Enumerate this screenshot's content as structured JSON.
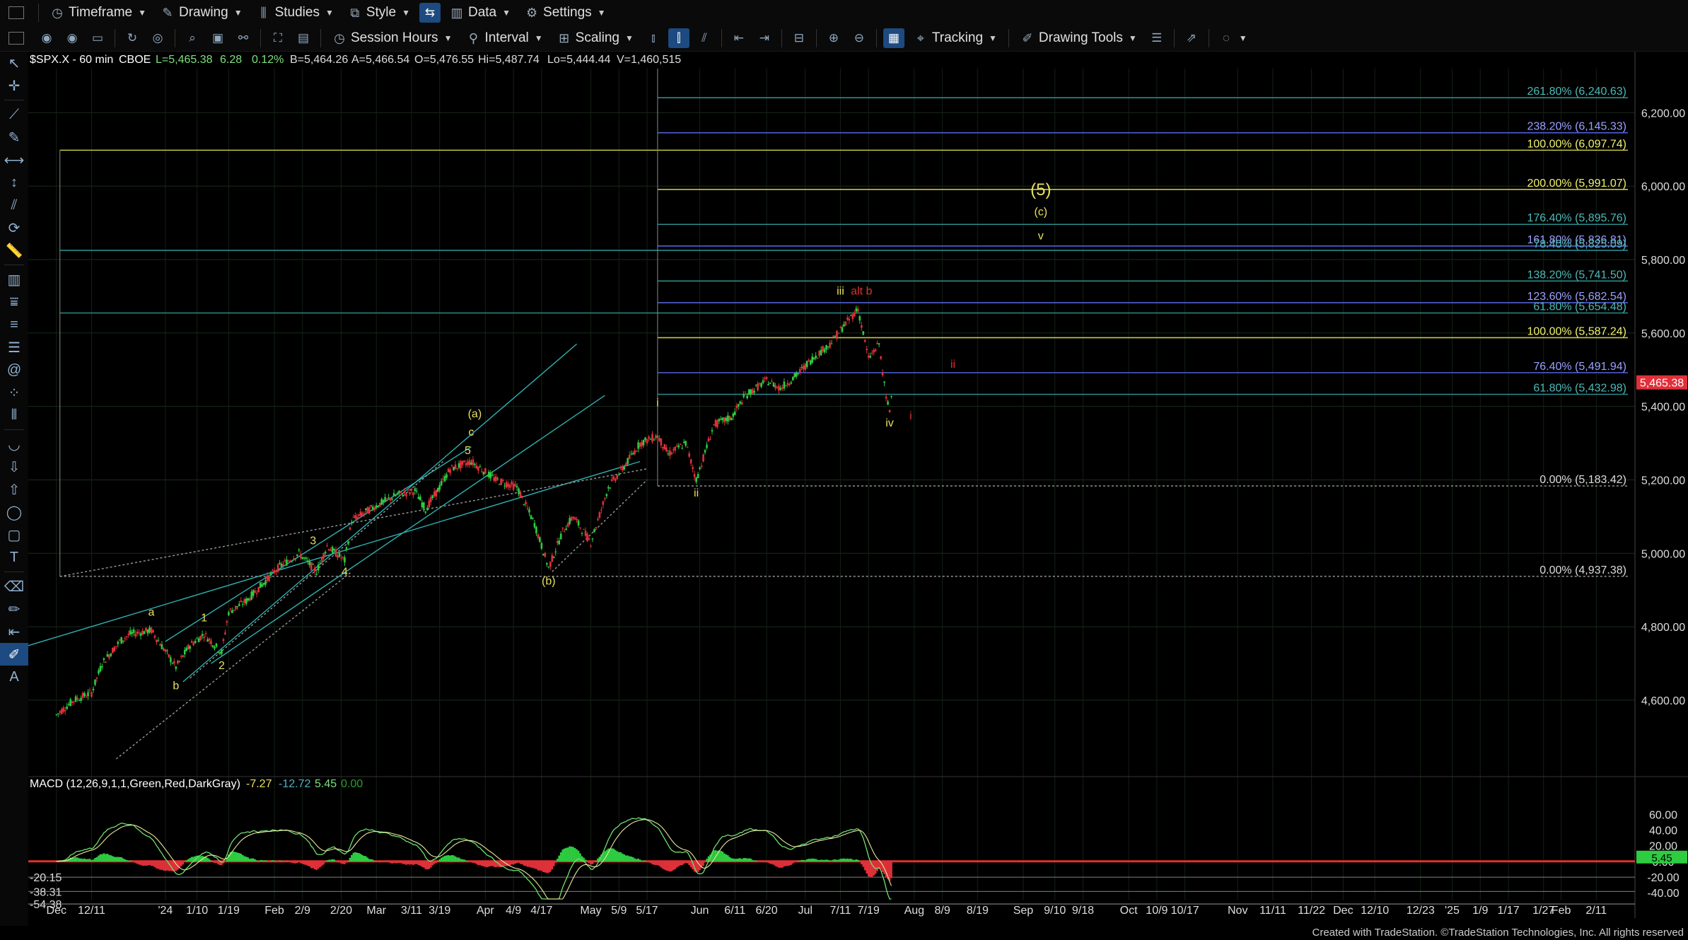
{
  "toolbar_top": {
    "timeframe": "Timeframe",
    "drawing": "Drawing",
    "studies": "Studies",
    "style": "Style",
    "data": "Data",
    "settings": "Settings"
  },
  "toolbar_second": {
    "session_hours": "Session Hours",
    "interval": "Interval",
    "scaling": "Scaling",
    "tracking": "Tracking",
    "drawing_tools": "Drawing Tools"
  },
  "header": {
    "symbol": "$SPX.X - 60 min",
    "exchange": "CBOE",
    "last": "L=5,465.38",
    "change": "6.28",
    "change_pct": "0.12%",
    "bid": "B=5,464.26",
    "ask": "A=5,466.54",
    "open": "O=5,476.55",
    "high": "Hi=5,487.74",
    "low": "Lo=5,444.44",
    "volume": "V=1,460,515"
  },
  "colors": {
    "up": "#2ecc40",
    "down": "#e0303a",
    "fib_teal": "#2a8c8c",
    "fib_blue": "#5060d8",
    "fib_yellow": "#c8c840",
    "label_yellow": "#e8e060",
    "label_red": "#e03030",
    "macd": "#6fe06f",
    "signal": "#e8e8a0",
    "channel": "#30b0b0"
  },
  "chart_data": {
    "type": "candlestick",
    "title": "$SPX.X - 60 min",
    "ylim": [
      4440,
      6320
    ],
    "y_ticks": [
      "4,600.00",
      "4,800.00",
      "5,000.00",
      "5,200.00",
      "5,400.00",
      "5,600.00",
      "5,800.00",
      "6,000.00",
      "6,200.00"
    ],
    "x_ticks": [
      "Dec",
      "12/11",
      "'24",
      "1/10",
      "1/19",
      "Feb",
      "2/9",
      "2/20",
      "Mar",
      "3/11",
      "3/19",
      "Apr",
      "4/9",
      "4/17",
      "May",
      "5/9",
      "5/17",
      "Jun",
      "6/11",
      "6/20",
      "Jul",
      "7/11",
      "7/19",
      "Aug",
      "8/9",
      "8/19",
      "Sep",
      "9/10",
      "9/18",
      "Oct",
      "10/9",
      "10/17",
      "Nov",
      "11/11",
      "11/22",
      "Dec",
      "12/10",
      "12/23",
      "'25",
      "1/9",
      "1/17",
      "1/27",
      "Feb",
      "2/11"
    ],
    "last_price_label": "5,465.38",
    "price_path": [
      [
        "2023-12-01",
        4560
      ],
      [
        "2023-12-06",
        4600
      ],
      [
        "2023-12-11",
        4620
      ],
      [
        "2023-12-14",
        4700
      ],
      [
        "2023-12-19",
        4760
      ],
      [
        "2023-12-22",
        4780
      ],
      [
        "2023-12-28",
        4790
      ],
      [
        "2024-01-04",
        4690
      ],
      [
        "2024-01-08",
        4750
      ],
      [
        "2024-01-12",
        4780
      ],
      [
        "2024-01-17",
        4730
      ],
      [
        "2024-01-19",
        4840
      ],
      [
        "2024-01-24",
        4870
      ],
      [
        "2024-01-29",
        4920
      ],
      [
        "2024-02-02",
        4960
      ],
      [
        "2024-02-08",
        5000
      ],
      [
        "2024-02-13",
        4950
      ],
      [
        "2024-02-16",
        5020
      ],
      [
        "2024-02-21",
        4980
      ],
      [
        "2024-02-23",
        5090
      ],
      [
        "2024-03-01",
        5130
      ],
      [
        "2024-03-07",
        5160
      ],
      [
        "2024-03-12",
        5170
      ],
      [
        "2024-03-15",
        5120
      ],
      [
        "2024-03-19",
        5180
      ],
      [
        "2024-03-22",
        5230
      ],
      [
        "2024-03-28",
        5250
      ],
      [
        "2024-04-04",
        5200
      ],
      [
        "2024-04-10",
        5180
      ],
      [
        "2024-04-15",
        5080
      ],
      [
        "2024-04-19",
        4960
      ],
      [
        "2024-04-23",
        5060
      ],
      [
        "2024-04-26",
        5100
      ],
      [
        "2024-05-01",
        5030
      ],
      [
        "2024-05-06",
        5180
      ],
      [
        "2024-05-10",
        5230
      ],
      [
        "2024-05-15",
        5300
      ],
      [
        "2024-05-20",
        5320
      ],
      [
        "2024-05-23",
        5270
      ],
      [
        "2024-05-28",
        5300
      ],
      [
        "2024-05-31",
        5200
      ],
      [
        "2024-06-05",
        5350
      ],
      [
        "2024-06-10",
        5370
      ],
      [
        "2024-06-14",
        5430
      ],
      [
        "2024-06-20",
        5470
      ],
      [
        "2024-06-24",
        5450
      ],
      [
        "2024-06-28",
        5480
      ],
      [
        "2024-07-03",
        5530
      ],
      [
        "2024-07-08",
        5570
      ],
      [
        "2024-07-12",
        5620
      ],
      [
        "2024-07-16",
        5666
      ],
      [
        "2024-07-19",
        5530
      ],
      [
        "2024-07-22",
        5570
      ],
      [
        "2024-07-24",
        5420
      ],
      [
        "2024-07-25",
        5390
      ],
      [
        "2024-07-26",
        5465
      ]
    ],
    "fib_lines": [
      {
        "label": "261.80% (6,240.63)",
        "price": 6240.63,
        "color": "teal"
      },
      {
        "label": "238.20% (6,145.33)",
        "price": 6145.33,
        "color": "blue"
      },
      {
        "label": "100.00% (6,097.74)",
        "price": 6097.74,
        "color": "yellow"
      },
      {
        "label": "200.00% (5,991.07)",
        "price": 5991.07,
        "color": "yellow"
      },
      {
        "label": "176.40% (5,895.76)",
        "price": 5895.76,
        "color": "teal"
      },
      {
        "label": "161.80% (5,836.81)",
        "price": 5836.81,
        "color": "blue"
      },
      {
        "label": "78.40% (5,825.09)",
        "price": 5825.09,
        "color": "teal"
      },
      {
        "label": "138.20% (5,741.50)",
        "price": 5741.5,
        "color": "teal"
      },
      {
        "label": "123.60% (5,682.54)",
        "price": 5682.54,
        "color": "blue"
      },
      {
        "label": "61.80% (5,654.48)",
        "price": 5654.48,
        "color": "teal"
      },
      {
        "label": "100.00% (5,587.24)",
        "price": 5587.24,
        "color": "yellow"
      },
      {
        "label": "76.40% (5,491.94)",
        "price": 5491.94,
        "color": "blue"
      },
      {
        "label": "61.80% (5,432.98)",
        "price": 5432.98,
        "color": "teal"
      },
      {
        "label": "0.00% (5,183.42)",
        "price": 5183.42,
        "color": "gray"
      },
      {
        "label": "0.00% (4,937.38)",
        "price": 4937.38,
        "color": "gray"
      }
    ],
    "wave_labels": [
      {
        "text": "a",
        "date": "2023-12-28",
        "price": 4830,
        "color": "yellow"
      },
      {
        "text": "b",
        "date": "2024-01-04",
        "price": 4630,
        "color": "yellow"
      },
      {
        "text": "1",
        "date": "2024-01-12",
        "price": 4815,
        "color": "yellow"
      },
      {
        "text": "2",
        "date": "2024-01-17",
        "price": 4685,
        "color": "yellow"
      },
      {
        "text": "3",
        "date": "2024-02-12",
        "price": 5025,
        "color": "yellow"
      },
      {
        "text": "4",
        "date": "2024-02-21",
        "price": 4940,
        "color": "yellow"
      },
      {
        "text": "5",
        "date": "2024-03-27",
        "price": 5270,
        "color": "yellow"
      },
      {
        "text": "c",
        "date": "2024-03-28",
        "price": 5320,
        "color": "yellow"
      },
      {
        "text": "(a)",
        "date": "2024-03-29",
        "price": 5370,
        "color": "yellow"
      },
      {
        "text": "(b)",
        "date": "2024-04-19",
        "price": 4915,
        "color": "yellow"
      },
      {
        "text": "i",
        "date": "2024-05-20",
        "price": 5400,
        "color": "yellow"
      },
      {
        "text": "ii",
        "date": "2024-05-31",
        "price": 5155,
        "color": "yellow"
      },
      {
        "text": "iii",
        "date": "2024-07-11",
        "price": 5705,
        "color": "yellow"
      },
      {
        "text": "alt b",
        "date": "2024-07-17",
        "price": 5705,
        "color": "red"
      },
      {
        "text": "iv",
        "date": "2024-07-25",
        "price": 5345,
        "color": "yellow"
      },
      {
        "text": "ii",
        "date": "2024-08-12",
        "price": 5505,
        "color": "red"
      },
      {
        "text": "i",
        "date": "2024-07-31",
        "price": 5365,
        "color": "red"
      },
      {
        "text": "(5)",
        "date": "2024-09-06",
        "price": 5975,
        "color": "yellow"
      },
      {
        "text": "(c)",
        "date": "2024-09-06",
        "price": 5920,
        "color": "yellow"
      },
      {
        "text": "v",
        "date": "2024-09-06",
        "price": 5855,
        "color": "yellow"
      }
    ],
    "macd": {
      "label": "MACD (12,26,9,1,1,Green,Red,DarkGray)",
      "value1": "-7.27",
      "value2": "-12.72",
      "value3": "5.45",
      "value4": "0.00",
      "ylim": [
        -48,
        72
      ],
      "y_ticks": [
        "60.00",
        "40.00",
        "20.00",
        "0.00",
        "-20.00",
        "-40.00"
      ],
      "level_labels": [
        "-20.15",
        "-38.31",
        "-54.38"
      ],
      "last_value": "5.45"
    }
  },
  "footer": "Created with TradeStation. ©TradeStation Technologies, Inc. All rights reserved"
}
